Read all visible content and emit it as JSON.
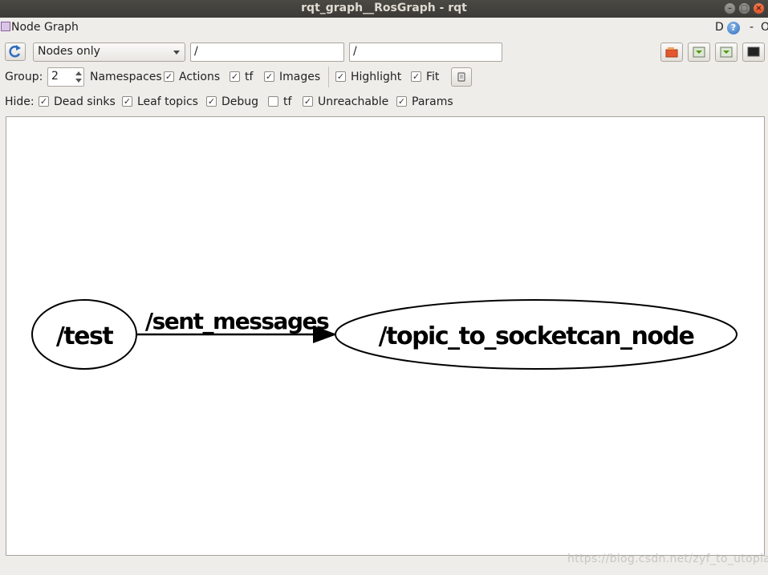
{
  "window": {
    "title": "rqt_graph__RosGraph - rqt",
    "controls": [
      "–",
      "□",
      "×"
    ]
  },
  "dock": {
    "title": "Node Graph",
    "d_label": "D",
    "help_glyph": "?",
    "dash_label": "-",
    "o_label": "O"
  },
  "toolbar": {
    "filter_mode": "Nodes only",
    "ns_filter": "/",
    "topic_filter": "/"
  },
  "group_row": {
    "group_label": "Group:",
    "group_value": "2",
    "options": [
      {
        "label": "Namespaces",
        "checked": true
      },
      {
        "label": "Actions",
        "checked": true
      },
      {
        "label": "tf",
        "checked": true
      },
      {
        "label": "Images",
        "checked": true
      },
      {
        "label": "Highlight",
        "checked": true
      },
      {
        "label": "Fit",
        "checked": true
      }
    ]
  },
  "hide_row": {
    "hide_label": "Hide:",
    "options": [
      {
        "label": "Dead sinks",
        "checked": true
      },
      {
        "label": "Leaf topics",
        "checked": true
      },
      {
        "label": "Debug",
        "checked": true
      },
      {
        "label": "tf",
        "checked": false
      },
      {
        "label": "Unreachable",
        "checked": true
      },
      {
        "label": "Params",
        "checked": true
      }
    ]
  },
  "graph": {
    "nodes": [
      {
        "name": "/test"
      },
      {
        "name": "/topic_to_socketcan_node"
      }
    ],
    "edges": [
      {
        "label": "/sent_messages",
        "from": "/test",
        "to": "/topic_to_socketcan_node"
      }
    ]
  },
  "watermark": "https://blog.csdn.net/zyf_to_utopia",
  "colors": {
    "titlebar": "#3c3b37",
    "window_bg": "#efedea",
    "canvas_bg": "#ffffff",
    "graph_ink": "#000000"
  },
  "icons": [
    "refresh-icon",
    "open-file-icon",
    "save-dot-icon",
    "save-image-icon",
    "screenshot-icon",
    "fit-view-icon",
    "help-icon"
  ]
}
